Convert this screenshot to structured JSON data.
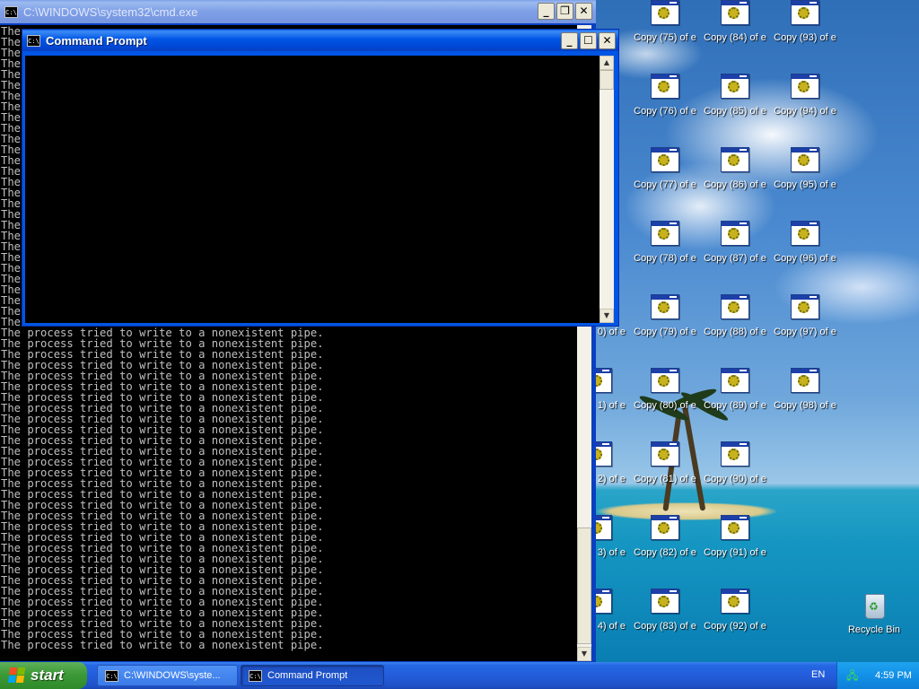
{
  "desktop": {
    "icons": {
      "partial": [
        "0) of e",
        "1) of e",
        "2) of e",
        "3) of e",
        "4) of e"
      ],
      "col2": [
        "Copy (75) of e",
        "Copy (76) of e",
        "Copy (77) of e",
        "Copy (78) of e",
        "Copy (79) of e",
        "Copy (80) of e",
        "Copy (81) of e",
        "Copy (82) of e",
        "Copy (83) of e"
      ],
      "col3": [
        "Copy (84) of e",
        "Copy (85) of e",
        "Copy (86) of e",
        "Copy (87) of e",
        "Copy (88) of e",
        "Copy (89) of e",
        "Copy (90) of e",
        "Copy (91) of e",
        "Copy (92) of e"
      ],
      "col4": [
        "Copy (93) of e",
        "Copy (94) of e",
        "Copy (95) of e",
        "Copy (96) of e",
        "Copy (97) of e",
        "Copy (98) of e"
      ]
    },
    "recycle_bin": "Recycle Bin"
  },
  "back_window": {
    "title": "C:\\WINDOWS\\system32\\cmd.exe",
    "icon": "cmd-icon",
    "covered_prefix": "The",
    "line": "The process tried to write to a nonexistent pipe."
  },
  "front_window": {
    "title": "Command Prompt",
    "icon": "cmd-icon"
  },
  "taskbar": {
    "start_label": "start",
    "tasks": [
      "C:\\WINDOWS\\syste...",
      "Command Prompt"
    ],
    "language": "EN",
    "clock": "4:59 PM"
  },
  "colors": {
    "taskbar_blue": "#245ddb",
    "start_green": "#3c9a37",
    "tray_blue": "#1290e6",
    "console_bg": "#000000",
    "console_fg": "#c0c0c0"
  }
}
